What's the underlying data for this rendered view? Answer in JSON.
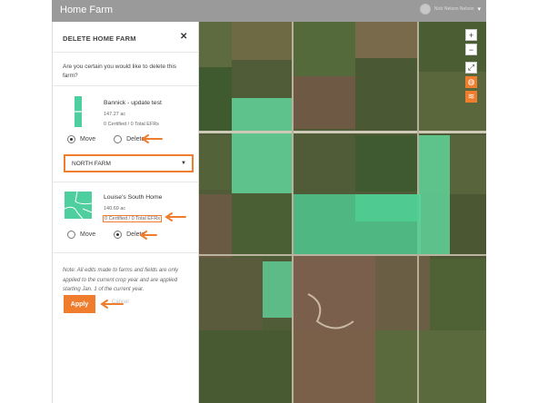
{
  "header": {
    "title": "Home Farm",
    "user_name": "Nick Nelson Nelson"
  },
  "dialog": {
    "title": "DELETE HOME FARM",
    "question": "Are you certain you would like to delete this farm?",
    "farms": [
      {
        "name": "Bannick - update test",
        "acres": "147.27 ac",
        "efr": "0 Certified / 0 Total EFRs",
        "options": [
          "Move",
          "Delete"
        ],
        "selected": "Move"
      },
      {
        "name": "Louise's South Home",
        "acres": "140.69 ac",
        "efr": "0 Certified / 0 Total EFRs",
        "options": [
          "Move",
          "Delete"
        ],
        "selected": "Delete"
      }
    ],
    "move_target": "NORTH FARM",
    "note": "Note: All edits made to farms and fields are only applied to the current crop year and are applied starting Jan. 1 of the current year.",
    "apply_label": "Apply",
    "cancel_label": "Cancel"
  },
  "map_controls": {
    "zoom_in": "+",
    "zoom_out": "−"
  },
  "colors": {
    "accent": "#f07d2e",
    "field_highlight": "#5fd39a",
    "thumb_green": "#4fcfa0"
  },
  "icons": [
    "close-icon",
    "chevron-down-icon",
    "fullscreen-icon",
    "globe-icon",
    "layers-icon",
    "arrow-left-icon"
  ]
}
